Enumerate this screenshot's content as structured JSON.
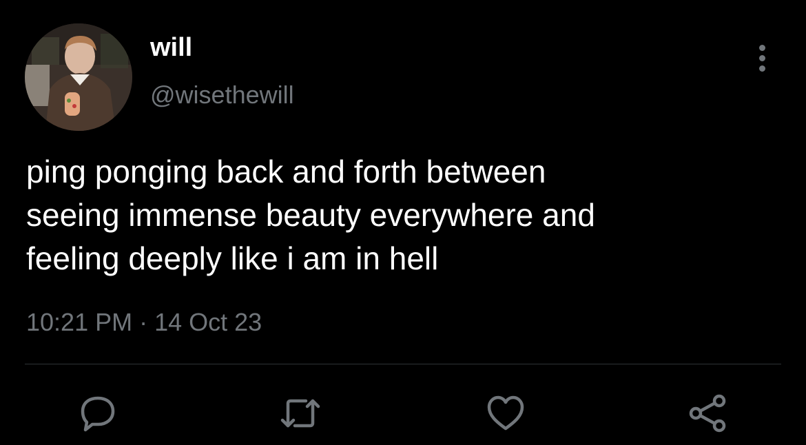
{
  "tweet": {
    "display_name": "will",
    "handle": "@wisethewill",
    "text": "ping ponging back and forth between\nseeing immense beauty everywhere and\nfeeling deeply like i am in hell",
    "time": "10:21 PM",
    "separator": " · ",
    "date": "14 Oct 23"
  },
  "actions": {
    "reply_icon": "reply-icon",
    "retweet_icon": "retweet-icon",
    "like_icon": "heart-icon",
    "share_icon": "share-icon"
  },
  "colors": {
    "background": "#000000",
    "primary_text": "#ffffff",
    "secondary_text": "#71767b",
    "divider": "#2f3336"
  }
}
